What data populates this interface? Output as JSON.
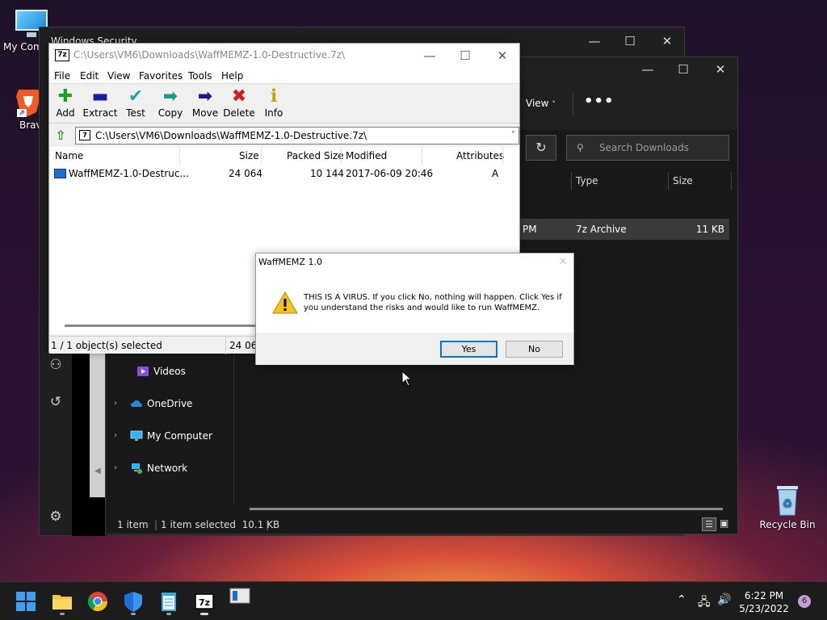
{
  "desktop": {
    "icons": [
      {
        "label": "My Com",
        "icon": "monitor-icon"
      },
      {
        "label": "Brav",
        "icon": "brave-browser-icon"
      },
      {
        "label": "Recycle Bin",
        "icon": "recycle-bin-icon"
      }
    ]
  },
  "windows_security": {
    "title": "Windows Security",
    "sidebar_icons": [
      "family-icon",
      "history-icon",
      "settings-gear-icon"
    ]
  },
  "explorer": {
    "view_label": "View",
    "more_label": "•••",
    "search_placeholder": "Search Downloads",
    "columns": [
      "Type",
      "Size"
    ],
    "file_row": {
      "date_fragment": "PM",
      "type": "7z Archive",
      "size": "11 KB"
    },
    "nav_items": [
      {
        "label": "Videos",
        "icon": "videos-folder-icon",
        "chevron": false
      },
      {
        "label": "OneDrive",
        "icon": "onedrive-cloud-icon",
        "chevron": true
      },
      {
        "label": "My Computer",
        "icon": "computer-icon",
        "chevron": true
      },
      {
        "label": "Network",
        "icon": "network-icon",
        "chevron": true
      }
    ],
    "status": {
      "count": "1 item",
      "selected": "1 item selected  10.1 KB"
    }
  },
  "zip": {
    "title": "C:\\Users\\VM6\\Downloads\\WaffMEMZ-1.0-Destructive.7z\\",
    "logo_text": "7z",
    "menu": [
      "File",
      "Edit",
      "View",
      "Favorites",
      "Tools",
      "Help"
    ],
    "toolbar": [
      {
        "label": "Add",
        "icon": "add-plus-icon",
        "color": "#1aa31a",
        "glyph": "✚"
      },
      {
        "label": "Extract",
        "icon": "extract-minus-icon",
        "color": "#1a1aa8",
        "glyph": "▬"
      },
      {
        "label": "Test",
        "icon": "test-check-icon",
        "color": "#1fa7a7",
        "glyph": "✔"
      },
      {
        "label": "Copy",
        "icon": "copy-arrow-icon",
        "color": "#1f9a8a",
        "glyph": "➡"
      },
      {
        "label": "Move",
        "icon": "move-arrow-icon",
        "color": "#1a1a8a",
        "glyph": "➡"
      },
      {
        "label": "Delete",
        "icon": "delete-x-icon",
        "color": "#d41a1a",
        "glyph": "✖"
      },
      {
        "label": "Info",
        "icon": "info-icon",
        "color": "#c9a400",
        "glyph": "ℹ"
      }
    ],
    "address": "C:\\Users\\VM6\\Downloads\\WaffMEMZ-1.0-Destructive.7z\\",
    "columns": [
      "Name",
      "Size",
      "Packed Size",
      "Modified",
      "Attributes"
    ],
    "rows": [
      {
        "name": "WaffMEMZ-1.0-Destruc...",
        "size": "24 064",
        "packed": "10 144",
        "modified": "2017-06-09 20:46",
        "attributes": "A"
      }
    ],
    "status": {
      "selected": "1 / 1 object(s) selected",
      "size": "24 064"
    }
  },
  "dialog": {
    "title": "WaffMEMZ 1.0",
    "close": "×",
    "message": "THIS IS A VIRUS. If you click No, nothing will happen. Click Yes if you understand the risks and would like to run WaffMEMZ.",
    "yes_label": "Yes",
    "no_label": "No"
  },
  "taskbar": {
    "apps": [
      "start-windows-icon",
      "file-explorer-icon",
      "chrome-icon",
      "windows-security-shield-icon",
      "notepad-icon",
      "7zip-icon",
      "waffmemz-app-icon"
    ],
    "clock_time": "6:22 PM",
    "clock_date": "5/23/2022",
    "notification_count": "6"
  }
}
